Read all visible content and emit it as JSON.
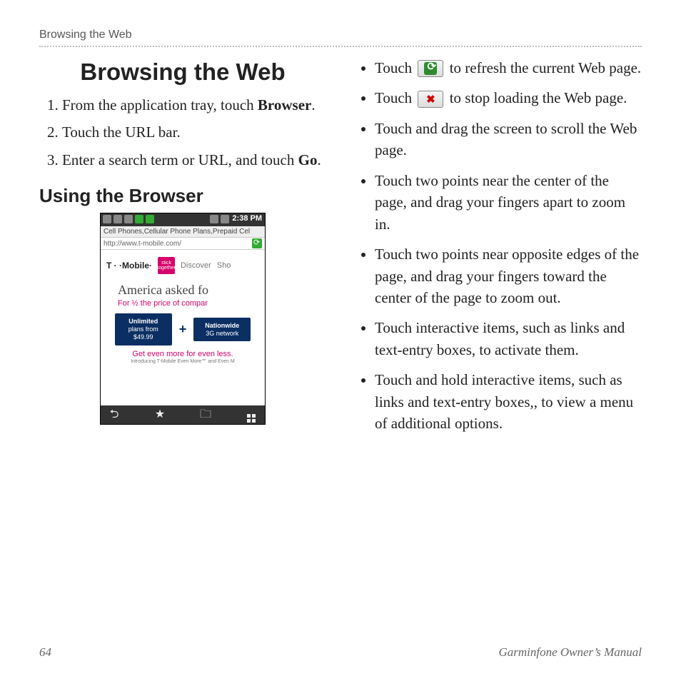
{
  "running_head": "Browsing the Web",
  "title": "Browsing the Web",
  "steps": {
    "s1a": "From the application tray, touch ",
    "s1b": "Browser",
    "s1c": ".",
    "s2": "Touch the URL bar.",
    "s3a": "Enter a search term or URL, and touch ",
    "s3b": "Go",
    "s3c": "."
  },
  "subhead": "Using the Browser",
  "tips": {
    "t1a": "Touch ",
    "t1b": " to refresh the current Web page.",
    "t2a": "Touch ",
    "t2b": " to stop loading the Web page.",
    "t3": "Touch and drag the screen to scroll the Web page.",
    "t4": "Touch two points near the center of the page, and drag your fingers apart to zoom in.",
    "t5": "Touch two points near opposite edges of the page, and drag your fingers toward the center of the page to zoom out.",
    "t6": "Touch interactive items, such as links and text-entry boxes, to activate them.",
    "t7": "Touch and hold interactive items, such as links and text-entry boxes,, to view a menu of additional options."
  },
  "phone": {
    "time": "2:38 PM",
    "page_title": "Cell Phones,Cellular Phone Plans,Prepaid Cel",
    "url": "http://www.t-mobile.com/",
    "logo": "T · ·Mobile·",
    "pink": "stick together",
    "nav1": "Discover",
    "nav2": "Sho",
    "headline": "America asked fo",
    "subline": "For ½ the price of compar",
    "plan1_bold": "Unlimited",
    "plan1_rest": "plans from $49.99",
    "plan2_bold": "Nationwide",
    "plan2_rest": "3G network",
    "more": "Get even more for even less.",
    "tiny": "Introducing T-Mobile Even More℠ and Even M"
  },
  "footer": {
    "page": "64",
    "manual": "Garminfone Owner’s Manual"
  }
}
